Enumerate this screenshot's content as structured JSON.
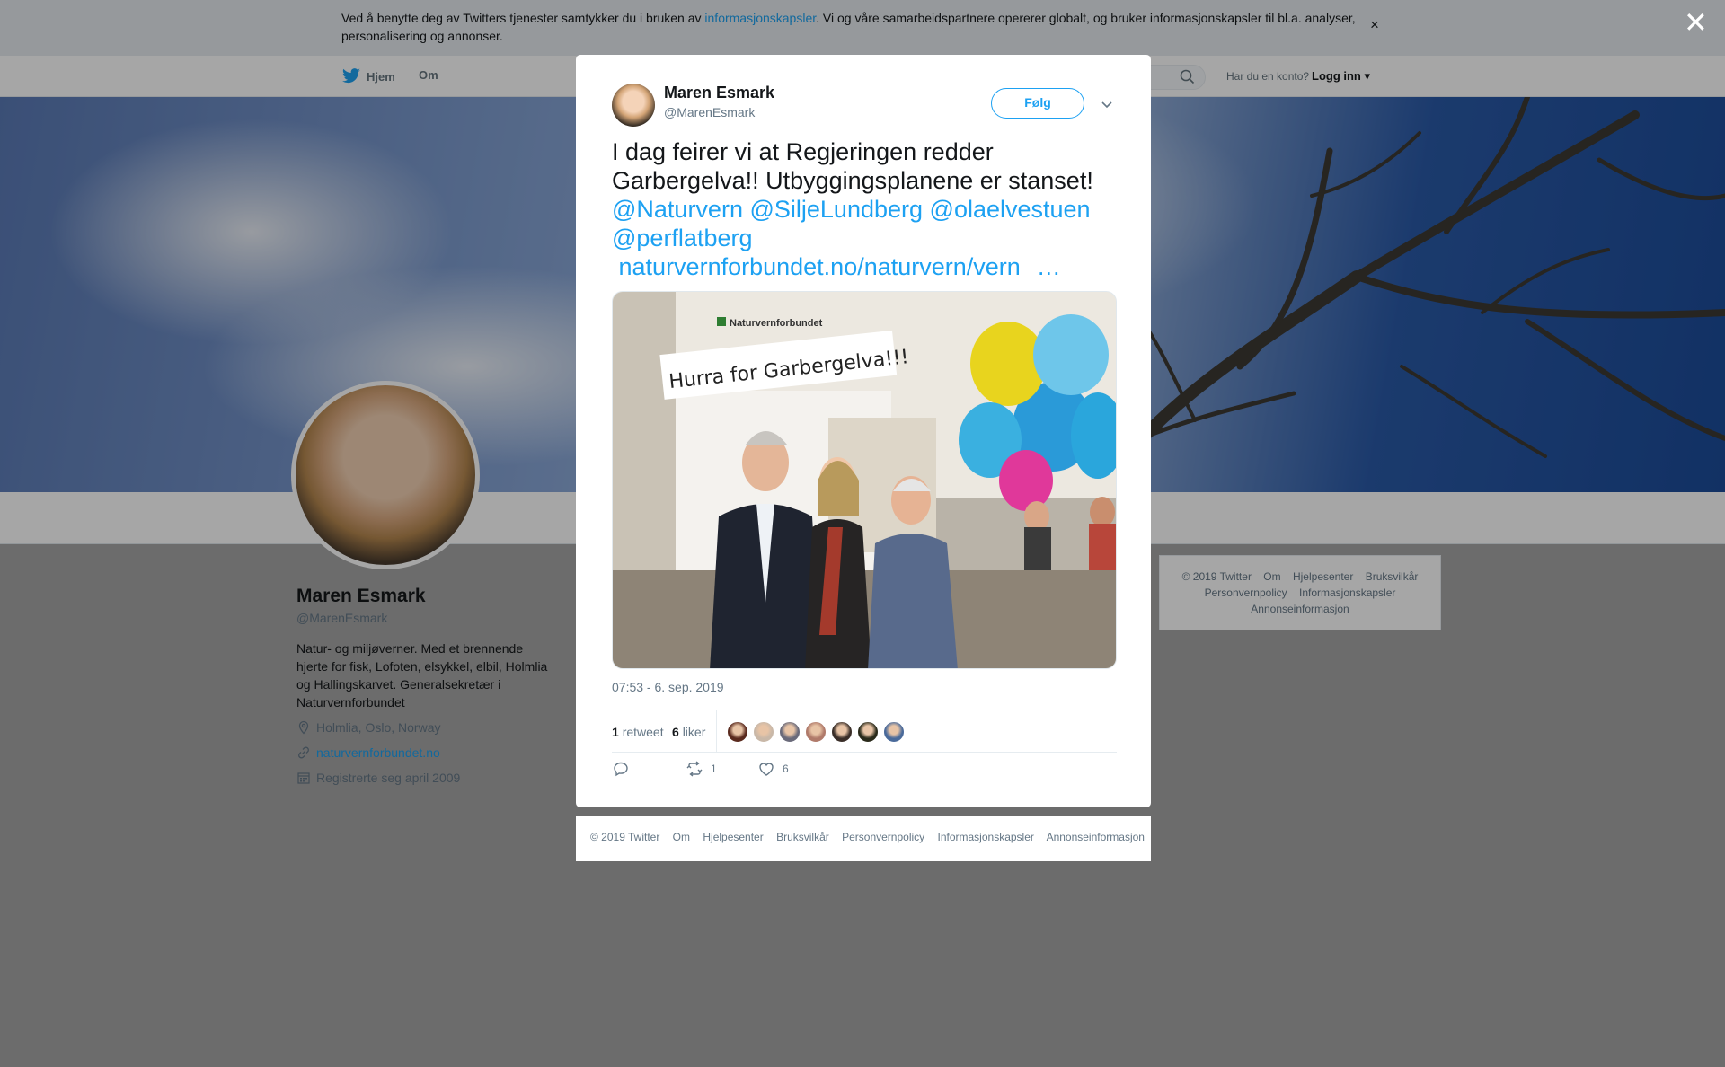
{
  "cookie": {
    "text_before": "Ved å benytte deg av Twitters tjenester samtykker du i bruken av ",
    "link": "informasjonskapsler",
    "text_after": ". Vi og våre samarbeidspartnere opererer globalt, og bruker informasjonskapsler til bl.a. analyser, personalisering og annonser.",
    "close": "×"
  },
  "nav": {
    "home": "Hjem",
    "about": "Om",
    "login_question": "Har du en konto?",
    "login": "Logg inn ▾"
  },
  "profile": {
    "name": "Maren Esmark",
    "handle": "@MarenEsmark",
    "bio": "Natur- og miljøverner. Med et brennende hjerte for fisk, Lofoten, elsykkel, elbil, Holmlia og Hallingskarvet. Generalsekretær i Naturvernforbundet",
    "location": "Holmlia, Oslo, Norway",
    "url": "naturvernforbundet.no",
    "joined": "Registrerte seg april 2009"
  },
  "right_footer": {
    "items": [
      "© 2019 Twitter",
      "Om",
      "Hjelpesenter",
      "Bruksvilkår",
      "Personvernpolicy",
      "Informasjonskapsler",
      "Annonseinformasjon"
    ]
  },
  "overlay": {
    "close": "✕"
  },
  "tweet": {
    "author_name": "Maren Esmark",
    "author_handle": "@MarenEsmark",
    "follow": "Følg",
    "text_line1": "I dag feirer vi at Regjeringen redder Garbergelva!! Utbyggingsplanene er stanset!",
    "mentions": [
      "@Naturvern",
      "@SiljeLundberg",
      "@olaelvestuen",
      "@perflatberg"
    ],
    "link": "naturvernforbundet.no/naturvern/vern",
    "ellipsis": "…",
    "image_banner": "Hurra for Garbergelva!!!",
    "image_logo": "Naturvernforbundet",
    "timestamp": "07:53 - 6. sep. 2019",
    "retweets_count": "1",
    "retweets_label": "retweet",
    "likes_count": "6",
    "likes_label": "liker",
    "reply_count": "",
    "retweet_action_count": "1",
    "like_action_count": "6",
    "liker_colors": [
      "#5a2a1e",
      "#c9b8a8",
      "#6a6a7a",
      "#b07a6a",
      "#3a2e28",
      "#2a2a1a",
      "#4a6a9a"
    ]
  },
  "bottom_footer": {
    "items": [
      "© 2019 Twitter",
      "Om",
      "Hjelpesenter",
      "Bruksvilkår",
      "Personvernpolicy",
      "Informasjonskapsler",
      "Annonseinformasjon"
    ]
  },
  "colors": {
    "accent": "#1da1f2",
    "text": "#14171a",
    "muted": "#657786"
  }
}
